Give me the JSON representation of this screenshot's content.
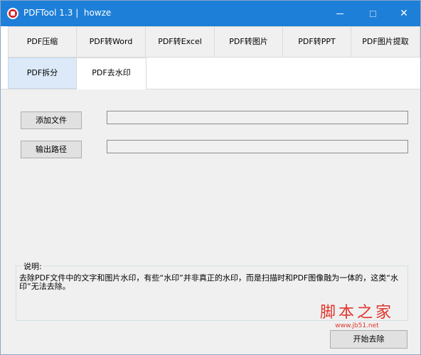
{
  "window": {
    "title": "PDFTool 1.3 |  howze",
    "controls": {
      "minimize": "minimize",
      "maximize": "maximize",
      "close": "✕"
    }
  },
  "tabs": {
    "row1": [
      "PDF压缩",
      "PDF转Word",
      "PDF转Excel",
      "PDF转图片",
      "PDF转PPT",
      "PDF图片提取"
    ],
    "row2": [
      "PDF拆分",
      "PDF去水印"
    ],
    "active": "PDF去水印"
  },
  "panel": {
    "add_file_button": "添加文件",
    "file_path_value": "",
    "output_path_button": "输出路径",
    "output_path_value": "",
    "description_title": "说明:",
    "description_text": "去除PDF文件中的文字和图片水印，有些“水印”并非真正的水印，而是扫描时和PDF图像融为一体的，这类“水印”无法去除。",
    "start_button": "开始去除"
  },
  "watermark": {
    "text": "脚本之家",
    "url": "www.jb51.net"
  },
  "colors": {
    "titlebar": "#1e7fd8",
    "highlight_tab": "#dbe9f8",
    "watermark": "#e0352b"
  }
}
